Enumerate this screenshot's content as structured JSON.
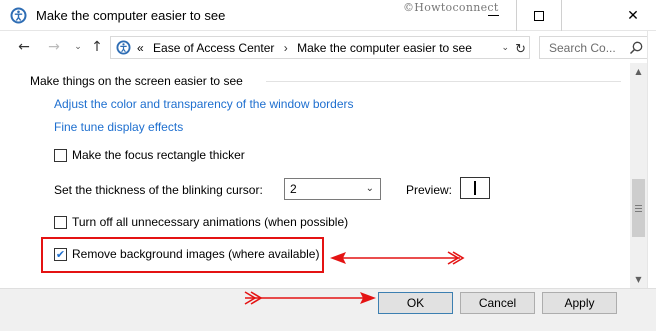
{
  "window": {
    "title": "Make the computer easier to see",
    "watermark": "©Howtoconnect",
    "minimize_icon": "minimize-icon",
    "maximize_icon": "maximize-icon",
    "close_icon": "close-icon",
    "close_glyph": "✕"
  },
  "nav": {
    "back_glyph": "←",
    "forward_glyph": "→",
    "recent_glyph": "⌄",
    "up_glyph": "↑"
  },
  "address": {
    "prefix": "«",
    "crumbs": [
      "Ease of Access Center",
      "Make the computer easier to see"
    ],
    "separator": "›",
    "chevron": "⌄",
    "refresh": "↻"
  },
  "search": {
    "placeholder": "Search Co..."
  },
  "content": {
    "section_heading": "Make things on the screen easier to see",
    "links": [
      "Adjust the color and transparency of the window borders",
      "Fine tune display effects"
    ],
    "focus_rect": {
      "label": "Make the focus rectangle thicker",
      "checked": false
    },
    "cursor_thickness": {
      "label": "Set the thickness of the blinking cursor:",
      "value": "2",
      "chevron": "⌄"
    },
    "preview": {
      "label": "Preview:"
    },
    "animations": {
      "label": "Turn off all unnecessary animations (when possible)",
      "checked": false
    },
    "background_images": {
      "label": "Remove background images (where available)",
      "checked": true,
      "check_glyph": "✔"
    }
  },
  "scrollbar": {
    "up_glyph": "▲",
    "down_glyph": "▼"
  },
  "buttons": {
    "ok": "OK",
    "cancel": "Cancel",
    "apply": "Apply"
  },
  "colors": {
    "link": "#1e6fcf",
    "annotation_red": "#e41313",
    "footer_bg": "#f0f0f0"
  }
}
